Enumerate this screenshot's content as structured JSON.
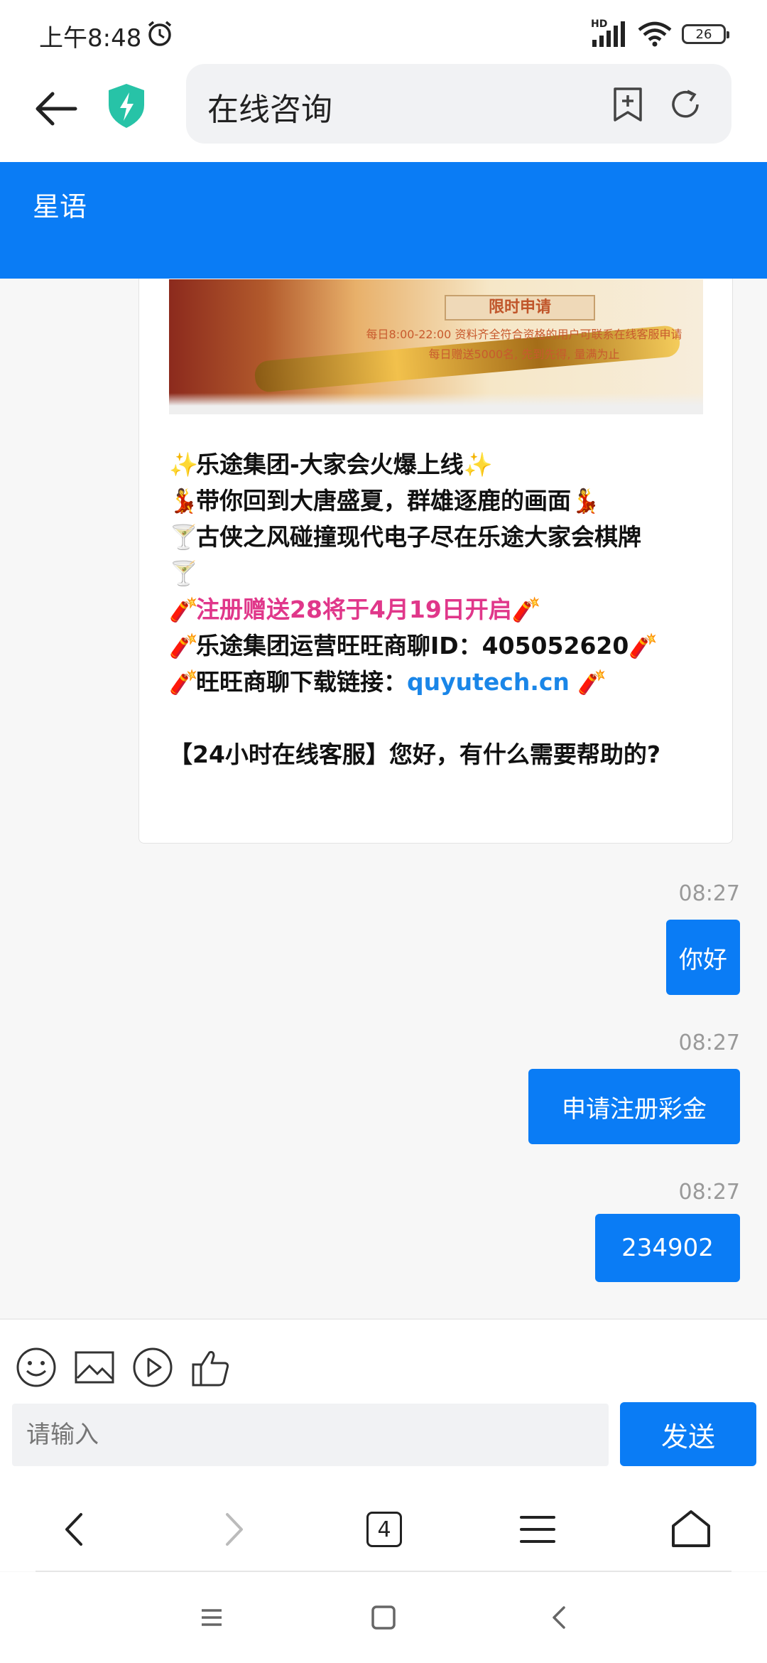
{
  "status_bar": {
    "time": "上午8:48",
    "network": "HD",
    "battery": "26"
  },
  "browser": {
    "url_title": "在线咨询",
    "tab_count": "4"
  },
  "page": {
    "title": "星语"
  },
  "banner": {
    "badge": "限时申请",
    "line1": "每日8:00-22:00 资料齐全符合资格的用户可联系在线客服申请",
    "line2": "每日赠送5000名, 先到先得, 量满为止"
  },
  "agent_message": {
    "line1": "乐途集团-大家会火爆上线",
    "line2": "带你回到大唐盛夏，群雄逐鹿的画面",
    "line3": "古侠之风碰撞现代电子尽在乐途大家会棋牌",
    "line4": "注册赠送28将于4月19日开启",
    "line5": "乐途集团运营旺旺商聊ID：405052620",
    "line6_prefix": "旺旺商聊下载链接：",
    "line6_link": "quyutech.cn",
    "line7": "【24小时在线客服】您好，有什么需要帮助的?"
  },
  "user_messages": [
    {
      "time": "08:27",
      "text": "你好"
    },
    {
      "time": "08:27",
      "text": "申请注册彩金"
    },
    {
      "time": "08:27",
      "text": "234902"
    }
  ],
  "input": {
    "placeholder": "请输入",
    "send_label": "发送"
  },
  "colors": {
    "accent": "#0a7cf5",
    "pink": "#e0378a",
    "link": "#1a86e8"
  }
}
